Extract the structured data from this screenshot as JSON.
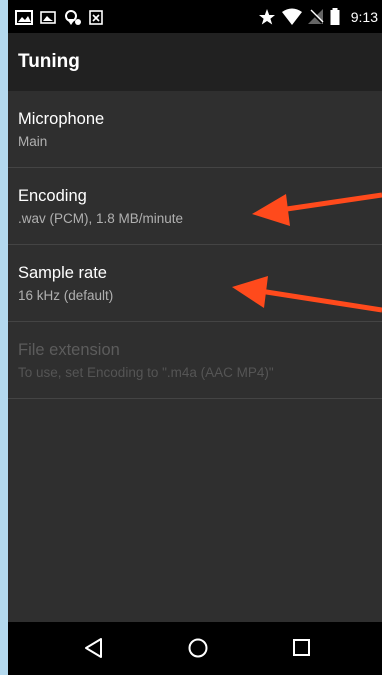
{
  "status_bar": {
    "time": "9:13",
    "left_icons": [
      "gallery-icon",
      "image-icon",
      "location-settings-icon",
      "close-box-icon"
    ],
    "right_icons": [
      "star-icon",
      "wifi-icon",
      "no-signal-icon",
      "battery-icon"
    ]
  },
  "app_bar": {
    "title": "Tuning"
  },
  "settings": [
    {
      "title": "Microphone",
      "summary": "Main",
      "enabled": true
    },
    {
      "title": "Encoding",
      "summary": ".wav (PCM), 1.8 MB/minute",
      "enabled": true
    },
    {
      "title": "Sample rate",
      "summary": "16 kHz (default)",
      "enabled": true
    },
    {
      "title": "File extension",
      "summary": "To use, set Encoding to \".m4a (AAC MP4)\"",
      "enabled": false
    }
  ],
  "nav_bar": {
    "buttons": [
      "back-icon",
      "home-icon",
      "recents-icon"
    ]
  },
  "annotations": {
    "arrow_color": "#ff4a1c",
    "targets": [
      "Encoding",
      "Sample rate"
    ]
  },
  "colors": {
    "background": "#b4d9ee",
    "screen": "#2f2f2f",
    "app_bar": "#212121",
    "status_bar": "#000000"
  }
}
